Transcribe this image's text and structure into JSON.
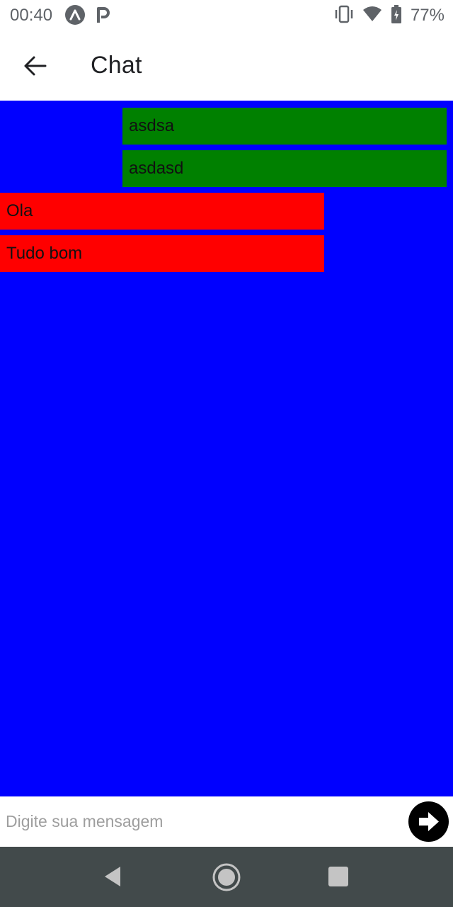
{
  "status_bar": {
    "time": "00:40",
    "battery": "77%",
    "icons": [
      "expo-app-icon",
      "p-app-icon",
      "vibrate-icon",
      "wifi-icon",
      "battery-charging-icon"
    ]
  },
  "header": {
    "title": "Chat",
    "back_icon": "arrow-left-icon"
  },
  "chat": {
    "background_color": "#0000ff",
    "sent_color": "#008000",
    "received_color": "#ff0000",
    "messages": [
      {
        "text": "asdsa",
        "direction": "sent"
      },
      {
        "text": "asdasd",
        "direction": "sent"
      },
      {
        "text": "Ola",
        "direction": "received"
      },
      {
        "text": "Tudo bom",
        "direction": "received"
      }
    ]
  },
  "input": {
    "placeholder": "Digite sua mensagem",
    "value": "",
    "send_icon": "arrow-right-circle-icon"
  },
  "nav_bar": {
    "icons": [
      "nav-back-icon",
      "nav-home-icon",
      "nav-recents-icon"
    ]
  }
}
